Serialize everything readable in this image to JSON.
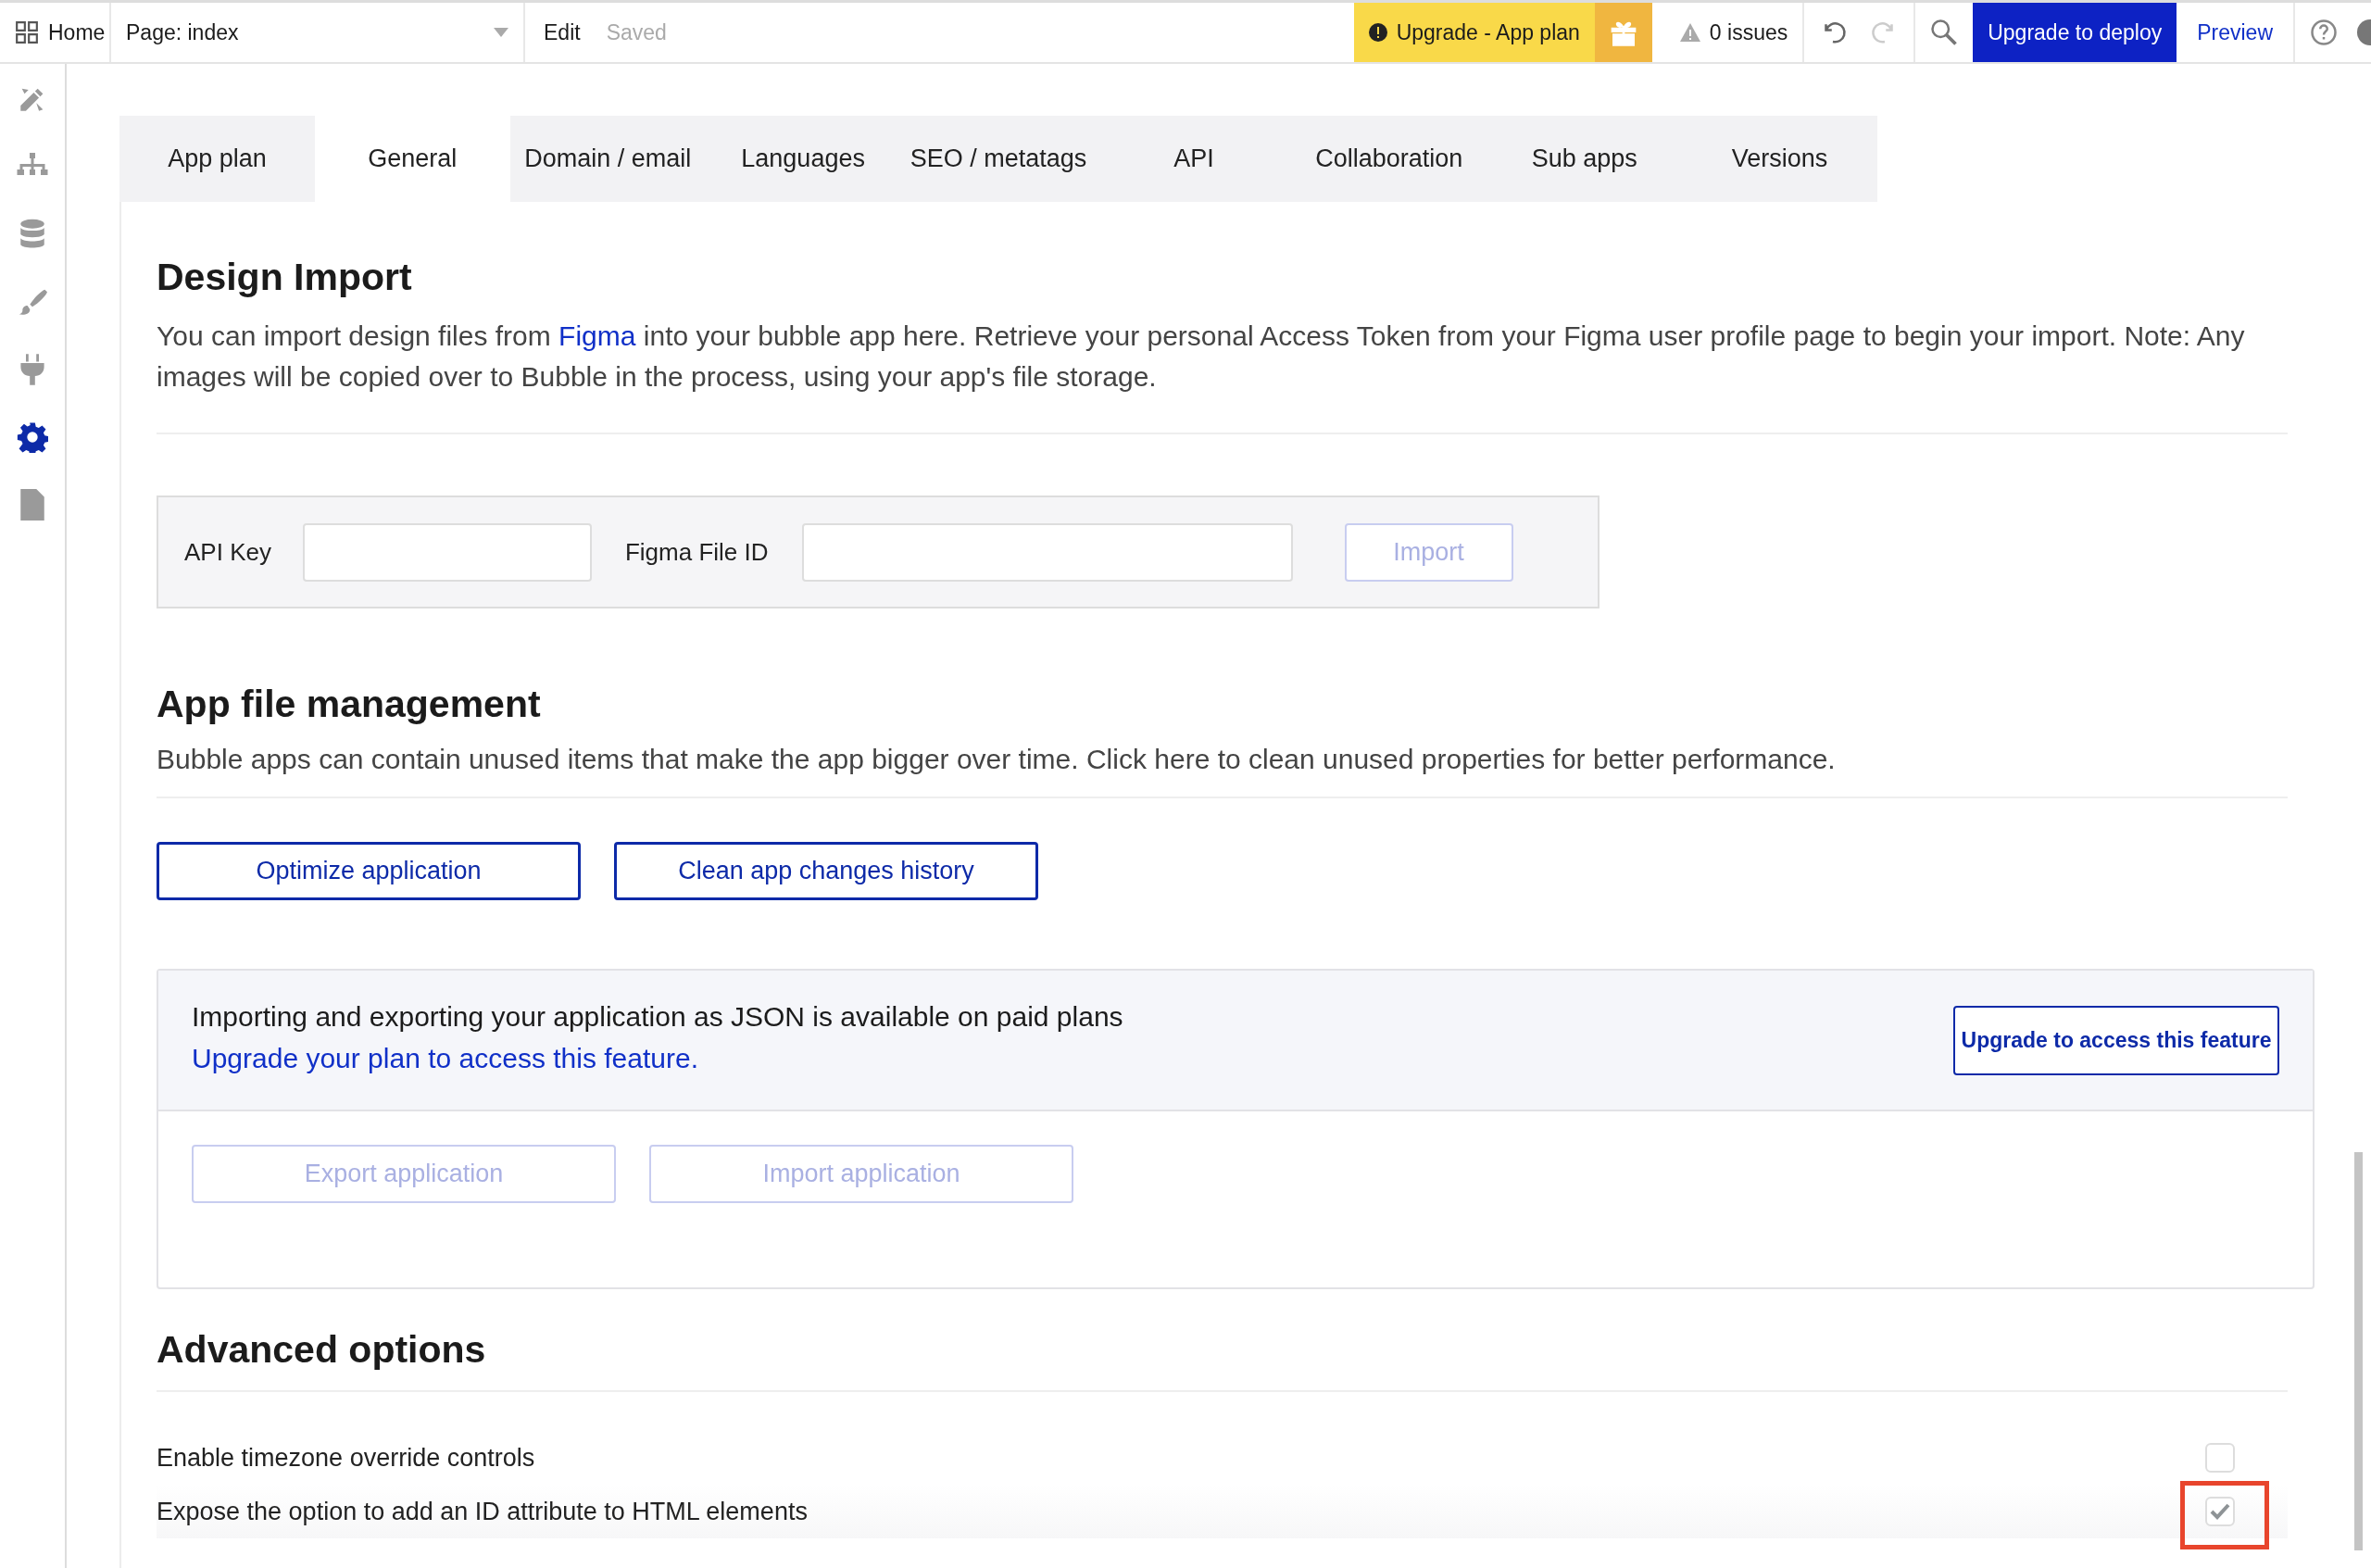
{
  "topbar": {
    "home": "Home",
    "page_select": "Page: index",
    "edit": "Edit",
    "saved": "Saved",
    "upgrade_plan": "Upgrade - App plan",
    "issues": "0 issues",
    "deploy": "Upgrade to deploy",
    "preview": "Preview"
  },
  "sidebar": {
    "items": [
      {
        "selected": false
      },
      {
        "selected": false
      },
      {
        "selected": false
      },
      {
        "selected": false
      },
      {
        "selected": false
      },
      {
        "selected": true
      },
      {
        "selected": false
      }
    ]
  },
  "tabs": [
    {
      "label": "App plan",
      "selected": false
    },
    {
      "label": "General",
      "selected": true
    },
    {
      "label": "Domain / email",
      "selected": false
    },
    {
      "label": "Languages",
      "selected": false
    },
    {
      "label": "SEO / metatags",
      "selected": false
    },
    {
      "label": "API",
      "selected": false
    },
    {
      "label": "Collaboration",
      "selected": false
    },
    {
      "label": "Sub apps",
      "selected": false
    },
    {
      "label": "Versions",
      "selected": false
    }
  ],
  "design_import": {
    "title": "Design Import",
    "description_before": "You can import design files from ",
    "description_link": "Figma",
    "description_after": " into your bubble app here. Retrieve your personal Access Token from your Figma user profile page to begin your import. Note: Any images will be copied over to Bubble in the process, using your app's file storage.",
    "fields": [
      {
        "label": "API Key"
      },
      {
        "label": "Figma File ID"
      }
    ],
    "import_button": {
      "label": "Import",
      "disabled": true
    }
  },
  "app_file": {
    "title": "App file management",
    "description": "Bubble apps can contain unused items that make the app bigger over time. Click here to clean unused properties for better performance.",
    "buttons": [
      {
        "label": "Optimize application",
        "disabled": false
      },
      {
        "label": "Clean app changes history",
        "disabled": false
      }
    ]
  },
  "json_section": {
    "notice": "Importing and exporting your application as JSON is available on paid plans",
    "link": "Upgrade your plan to access this feature.",
    "upgrade_button": "Upgrade to access this feature",
    "buttons": [
      {
        "label": "Export application",
        "disabled": true
      },
      {
        "label": "Import application",
        "disabled": true
      }
    ]
  },
  "advanced": {
    "title": "Advanced options",
    "options": [
      {
        "label": "Enable timezone override controls",
        "checked": false,
        "highlighted": false
      },
      {
        "label": "Expose the option to add an ID attribute to HTML elements",
        "checked": true,
        "highlighted": true
      }
    ]
  }
}
